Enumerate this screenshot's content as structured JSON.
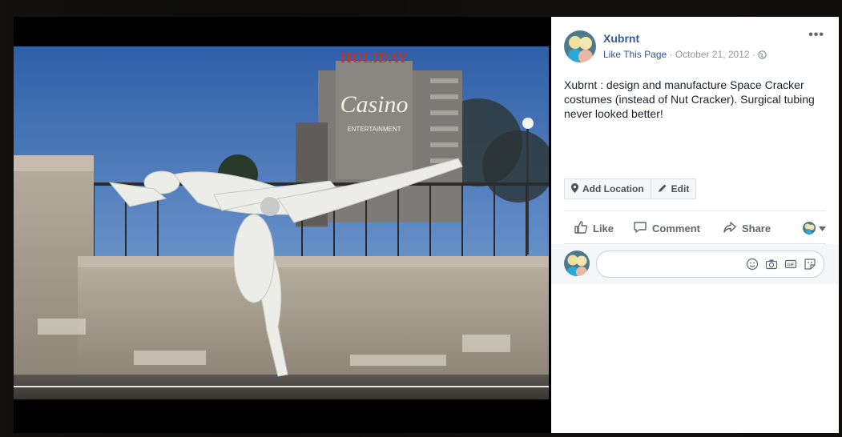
{
  "post": {
    "page_name": "Xubrnt",
    "like_page_label": "Like This Page",
    "separator": " · ",
    "date": "October 21, 2012",
    "trailing_separator": " · ",
    "audience_icon": "globe-icon",
    "more_label": "•••",
    "text": "Xubrnt : design and manufacture Space Cracker costumes (instead of Nut Cracker). Surgical tubing never looked better!"
  },
  "tags": {
    "add_location_label": "Add Location",
    "add_location_icon": "location-pin-icon",
    "edit_label": "Edit",
    "edit_icon": "pencil-icon"
  },
  "actions": {
    "like_label": "Like",
    "like_icon": "thumbs-up-icon",
    "comment_label": "Comment",
    "comment_icon": "speech-bubble-icon",
    "share_label": "Share",
    "share_icon": "share-arrow-icon",
    "audience_icon": "chevron-down-icon"
  },
  "comment": {
    "placeholder": "",
    "icons": [
      "emoji-icon",
      "camera-icon",
      "gif-icon",
      "sticker-icon"
    ]
  },
  "photo": {
    "sign_top": "HOLIDAY",
    "sign_main": "Casino",
    "sign_bottom": "ENTERTAINMENT"
  },
  "colors": {
    "link": "#365899",
    "meta": "#90949c",
    "text": "#1d2129",
    "action": "#606770"
  }
}
